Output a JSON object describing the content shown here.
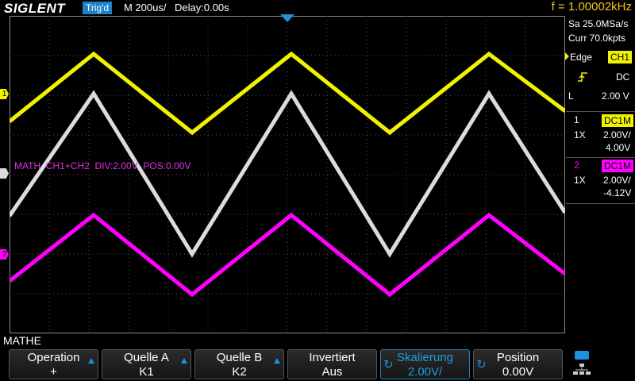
{
  "header": {
    "brand": "SIGLENT",
    "trig_status": "Trig'd",
    "timebase": "M 200us/",
    "delay": "Delay:0.00s",
    "frequency": "f = 1.00002kHz"
  },
  "acquisition": {
    "sample_rate": "Sa 25.0MSa/s",
    "memory_depth": "Curr 70.0kpts"
  },
  "trigger": {
    "type": "Edge",
    "source": "CH1",
    "coupling": "DC",
    "level_label": "L",
    "level": "2.00 V"
  },
  "channels": [
    {
      "number": "1",
      "coupling": "DC1M",
      "probe": "1X",
      "scale": "2.00V/",
      "offset": "4.00V",
      "color": "#f2f200"
    },
    {
      "number": "2",
      "coupling": "DC1M",
      "probe": "1X",
      "scale": "2.00V/",
      "offset": "-4.12V",
      "color": "#ff00ff"
    }
  ],
  "markers": {
    "ch1": "1",
    "ch2": "2"
  },
  "math_annotation": "MATH  CH1+CH2  DIV:2.00V  POS:0.00V",
  "menu_title": "MATHE",
  "softkeys": [
    {
      "label": "Operation",
      "value": "+"
    },
    {
      "label": "Quelle A",
      "value": "K1"
    },
    {
      "label": "Quelle B",
      "value": "K2"
    },
    {
      "label": "Invertiert",
      "value": "Aus"
    },
    {
      "label": "Skalierung",
      "value": "2.00V/"
    },
    {
      "label": "Position",
      "value": "0.00V"
    }
  ],
  "colors": {
    "ch1": "#f2f200",
    "ch2": "#ff00ff",
    "math": "#dcdcdc",
    "accent": "#1e82c8"
  }
}
